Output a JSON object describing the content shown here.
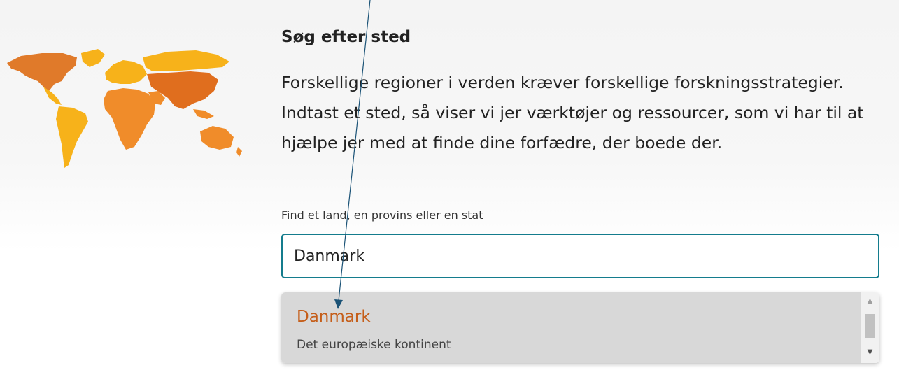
{
  "search_section": {
    "heading": "Søg efter sted",
    "description": "Forskellige regioner i verden kræver forskellige forskningsstrategier. Indtast et sted, så viser vi jer værktøjer og ressourcer, som vi har til at hjælpe jer med at finde dine forfædre, der boede der.",
    "field_label": "Find et land, en provins eller en stat",
    "input_value": "Danmark"
  },
  "suggestions": [
    {
      "name": "Danmark",
      "region": "Det europæiske kontinent"
    }
  ],
  "colors": {
    "input_border": "#147c8d",
    "suggestion_name": "#c55e1a",
    "suggestion_highlight": "#d8d8d8",
    "map_americas_europe": "#f7b21a",
    "map_north_america": "#e07a2a",
    "map_africa_australia": "#f08c2a",
    "map_asia": "#e06e1e",
    "annotation_arrow": "#1a5276"
  },
  "icons": {
    "world_map": "world-map-illustration",
    "scroll_up": "scroll-up-arrow-icon",
    "scroll_down": "scroll-down-arrow-icon"
  }
}
